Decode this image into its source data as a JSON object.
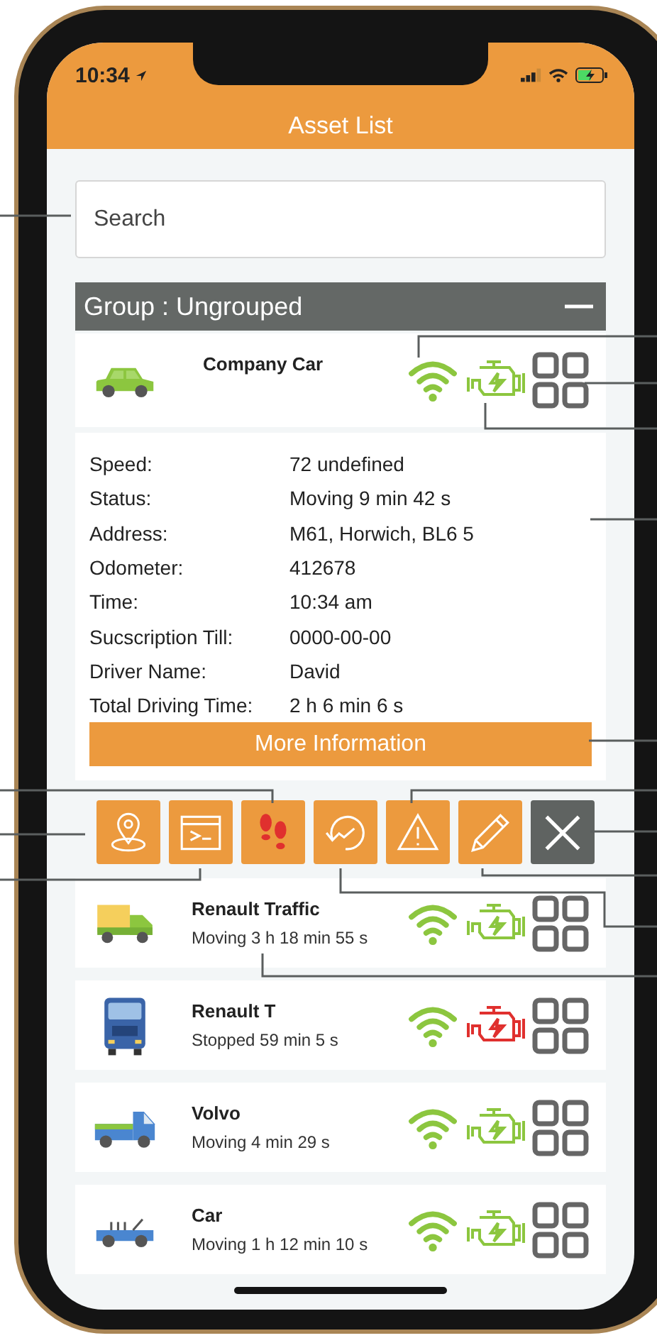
{
  "status_bar": {
    "time": "10:34"
  },
  "header": {
    "title": "Asset List"
  },
  "search": {
    "placeholder": "Search"
  },
  "group": {
    "title": "Group : Ungrouped",
    "expanded": true
  },
  "selected_vehicle": {
    "name": "Company Car",
    "kind": "car",
    "engine_alert": false,
    "details": [
      {
        "label": "Speed:",
        "value": "72 undefined"
      },
      {
        "label": "Status:",
        "value": "Moving 9 min 42 s"
      },
      {
        "label": "Address:",
        "value": "M61, Horwich, BL6 5"
      },
      {
        "label": "Odometer:",
        "value": "412678"
      },
      {
        "label": "Time:",
        "value": "10:34 am"
      },
      {
        "label": "Sucscription Till:",
        "value": "0000-00-00"
      },
      {
        "label": "Driver Name:",
        "value": "David"
      },
      {
        "label": "Total Driving Time:",
        "value": "2 h 6 min 6 s"
      }
    ],
    "more_button": "More Information"
  },
  "actions": [
    {
      "kind": "location"
    },
    {
      "kind": "terminal"
    },
    {
      "kind": "footsteps"
    },
    {
      "kind": "history"
    },
    {
      "kind": "warning"
    },
    {
      "kind": "edit"
    },
    {
      "kind": "close"
    }
  ],
  "vehicles": [
    {
      "name": "Renault Traffic",
      "status": "Moving 3 h 18 min 55 s",
      "kind": "van",
      "engine_alert": false
    },
    {
      "name": "Renault T",
      "status": "Stopped 59 min 5 s",
      "kind": "truck",
      "engine_alert": true
    },
    {
      "name": "Volvo",
      "status": "Moving 4 min 29 s",
      "kind": "pickup",
      "engine_alert": false
    },
    {
      "name": "Car",
      "status": "Moving 1 h 12 min 10 s",
      "kind": "convertible",
      "engine_alert": false
    }
  ]
}
